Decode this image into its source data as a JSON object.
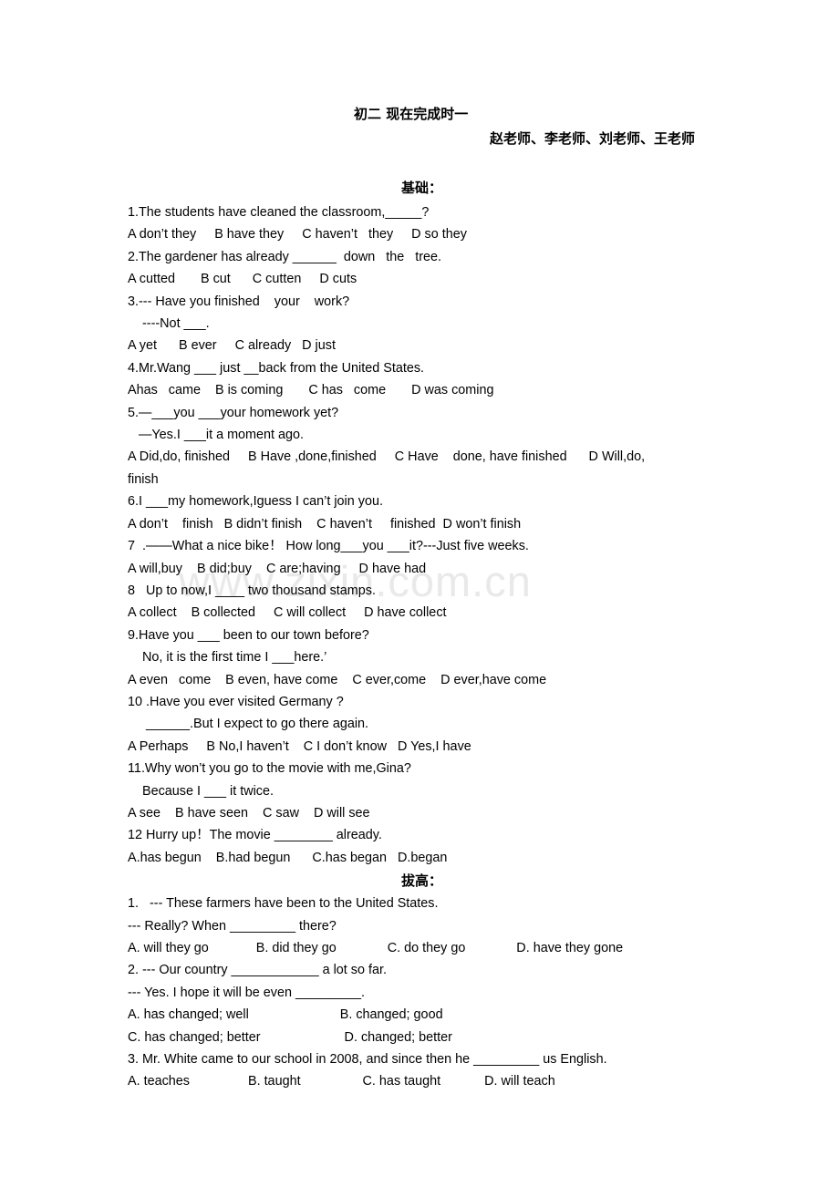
{
  "document": {
    "title": "初二 现在完成时一",
    "authors": "赵老师、李老师、刘老师、王老师",
    "watermark": "www.zixin.com.cn",
    "sections": [
      {
        "heading": "基础：",
        "lines": [
          "1.The students have cleaned the classroom,_____?",
          "A don’t they     B have they     C haven’t   they     D so they",
          "2.The gardener has already ______  down   the   tree.",
          "A cutted       B cut      C cutten     D cuts",
          "3.--- Have you finished    your    work?",
          "    ----Not ___.",
          "A yet      B ever     C already   D just",
          "4.Mr.Wang ___ just __back from the United States.",
          "Ahas   came    B is coming       C has   come       D was coming",
          "5.—___you ___your homework yet?",
          "   —Yes.I ___it a moment ago.",
          "A Did,do, finished     B Have ,done,finished     C Have    done, have finished      D Will,do,",
          "finish",
          "6.I ___my homework,Iguess I can’t join you.",
          "A don’t    finish   B didn’t finish    C haven’t     finished  D won’t finish",
          "7  .——What a nice bike！ How long___you ___it?---Just five weeks.",
          "A will,buy    B did;buy    C are;having     D have had",
          "8   Up to now,I ____ two thousand stamps.",
          "A collect    B collected     C will collect     D have collect",
          "9.Have you ___ been to our town before?",
          "    No, it is the first time I ___here.’",
          "A even   come    B even, have come    C ever,come    D ever,have come",
          "10 .Have you ever visited Germany ?",
          "     ______.But I expect to go there again.",
          "A Perhaps     B No,I haven’t    C I don’t know   D Yes,I have",
          "11.Why won’t you go to the movie with me,Gina?",
          "    Because I ___ it twice.",
          "A see    B have seen    C saw    D will see",
          "12 Hurry up！The movie ________ already.",
          "A.has begun    B.had begun      C.has began   D.began"
        ]
      },
      {
        "heading": "拔高：",
        "lines": [
          "1.   --- These farmers have been to the United States.",
          "--- Really? When _________ there?",
          "A. will they go             B. did they go              C. do they go              D. have they gone",
          "2. --- Our country ____________ a lot so far.",
          "--- Yes. I hope it will be even _________.",
          "A. has changed; well                         B. changed; good",
          "C. has changed; better                       D. changed; better",
          "3. Mr. White came to our school in 2008, and since then he _________ us English.",
          "A. teaches                B. taught                 C. has taught            D. will teach"
        ]
      }
    ]
  }
}
